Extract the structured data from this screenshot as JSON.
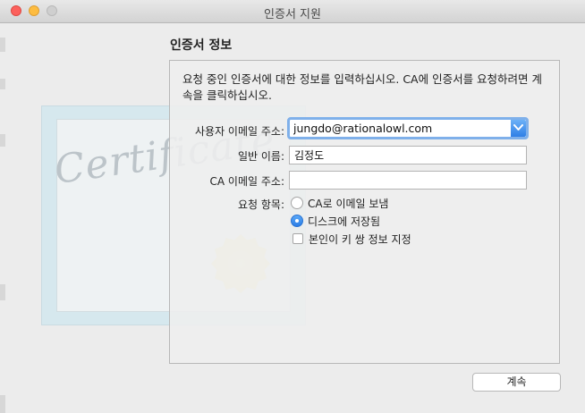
{
  "window": {
    "title": "인증서 지원"
  },
  "section": {
    "title": "인증서 정보"
  },
  "intro": "요청 중인 인증서에 대한 정보를 입력하십시오. CA에 인증서를 요청하려면 계속을 클릭하십시오.",
  "form": {
    "email_label": "사용자 이메일 주소:",
    "email_value": "jungdo@rationalowl.com",
    "name_label": "일반 이름:",
    "name_value": "김정도",
    "ca_email_label": "CA 이메일 주소:",
    "ca_email_value": "",
    "request_label": "요청 항목:",
    "options": {
      "email_to_ca": "CA로 이메일 보냄",
      "save_to_disk": "디스크에 저장됨",
      "key_pair": "본인이 키 쌍 정보 지정"
    },
    "selected_option": "save_to_disk",
    "key_pair_checked": false
  },
  "buttons": {
    "continue": "계속"
  },
  "icons": [
    "close-icon",
    "minimize-icon",
    "zoom-icon",
    "dropdown-arrow-icon",
    "certificate-icon"
  ],
  "colors": {
    "accent": "#2f7fe6",
    "focus_ring": "#7fb0ea",
    "close": "#fc605c",
    "minimize": "#fdbc40"
  }
}
